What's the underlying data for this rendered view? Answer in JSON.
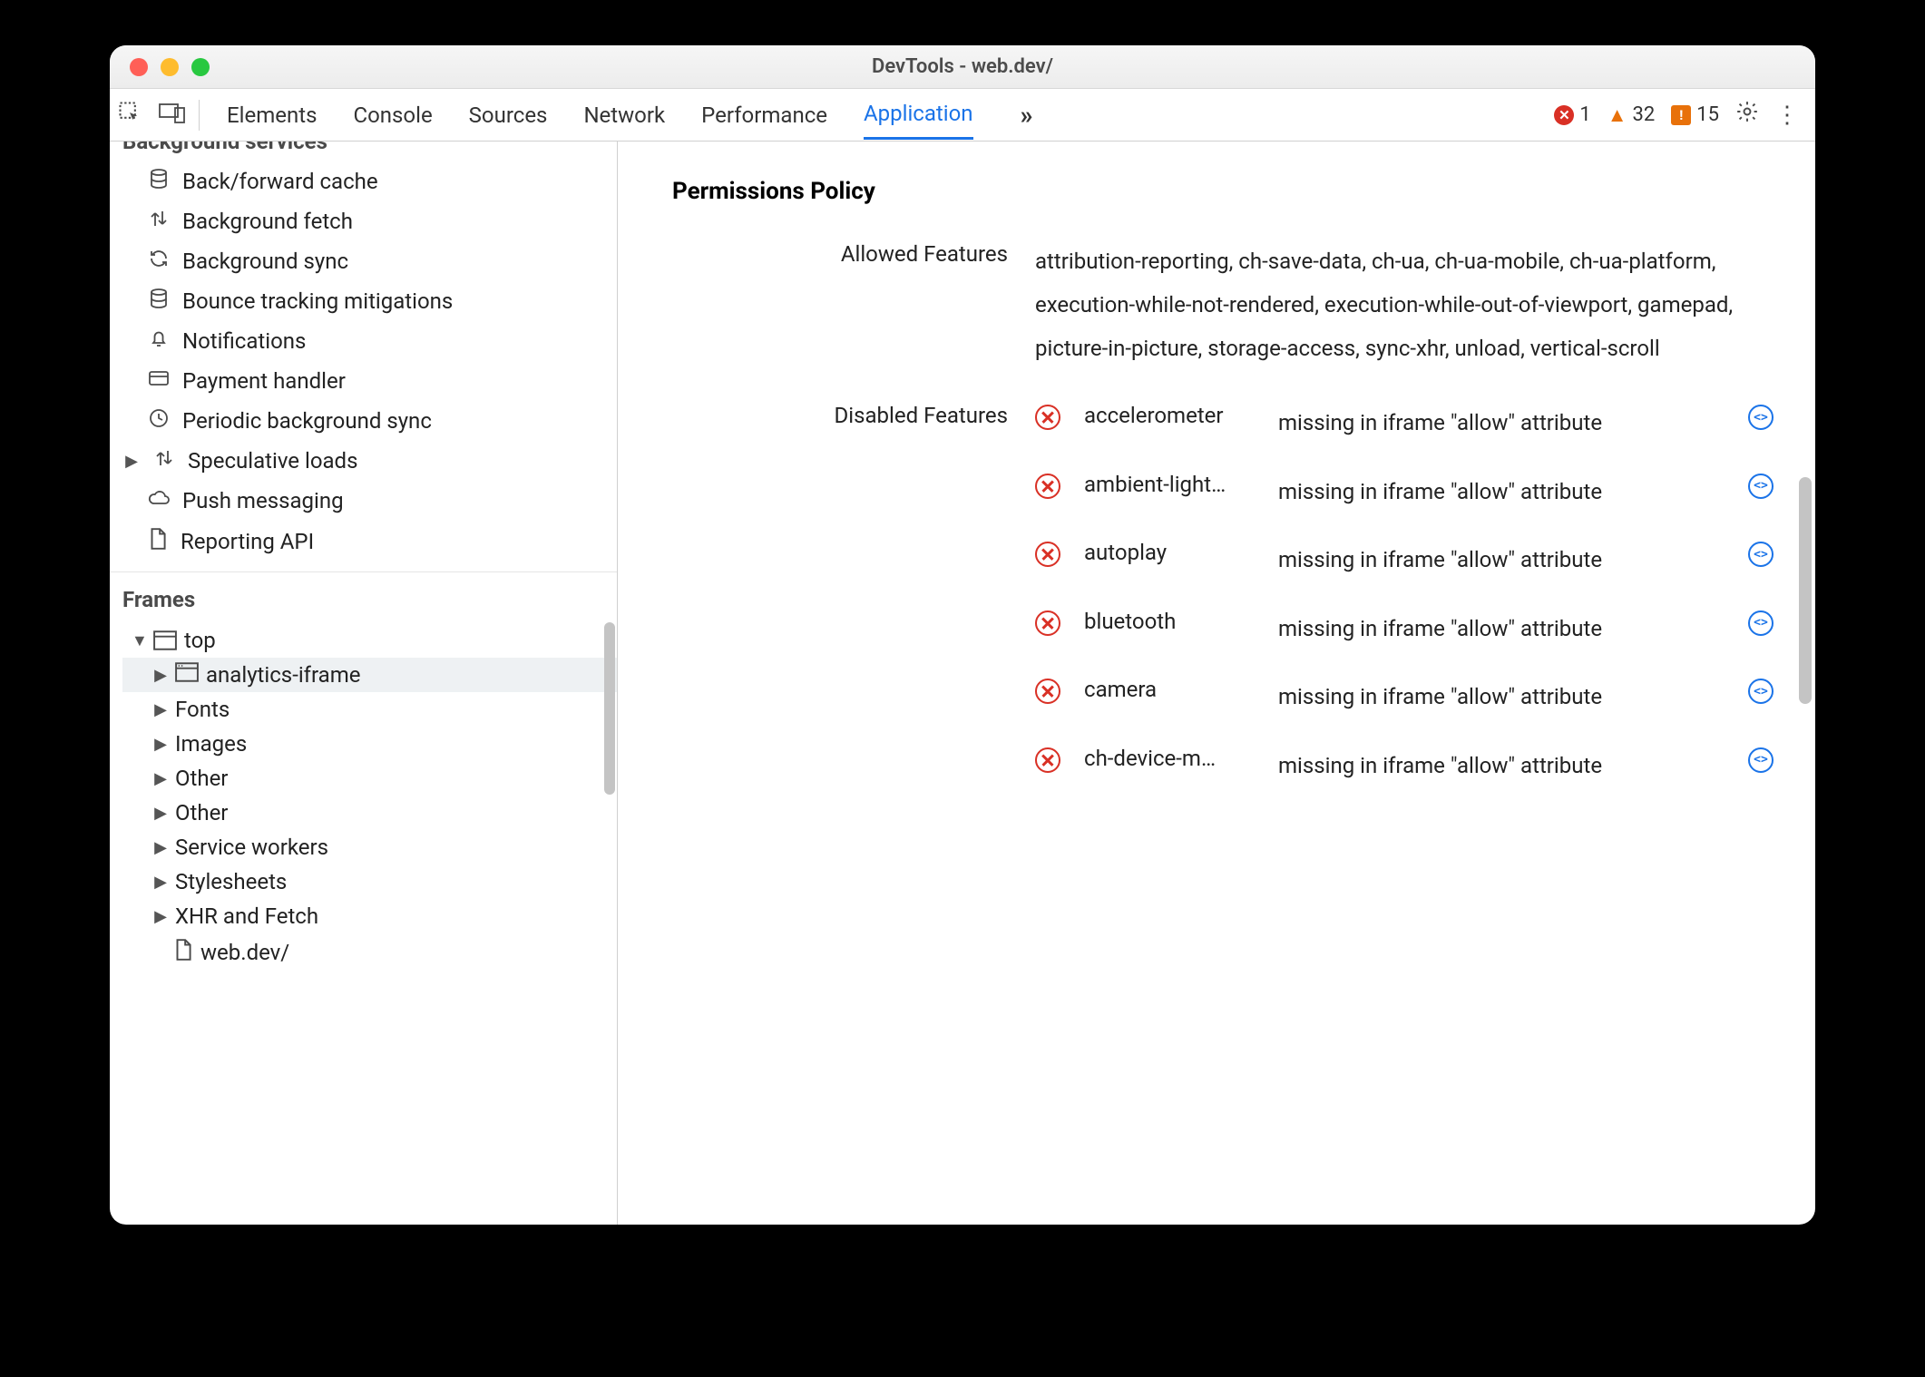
{
  "window": {
    "title": "DevTools - web.dev/"
  },
  "toolbar": {
    "tabs": [
      "Elements",
      "Console",
      "Sources",
      "Network",
      "Performance",
      "Application"
    ],
    "active_tab": "Application",
    "errors": "1",
    "warnings": "32",
    "issues": "15"
  },
  "sidebar": {
    "bg_services_header": "Background services",
    "bg_services": [
      {
        "label": "Back/forward cache",
        "icon": "database"
      },
      {
        "label": "Background fetch",
        "icon": "updown"
      },
      {
        "label": "Background sync",
        "icon": "sync"
      },
      {
        "label": "Bounce tracking mitigations",
        "icon": "database"
      },
      {
        "label": "Notifications",
        "icon": "bell"
      },
      {
        "label": "Payment handler",
        "icon": "card"
      },
      {
        "label": "Periodic background sync",
        "icon": "clock"
      },
      {
        "label": "Speculative loads",
        "icon": "updown",
        "expandable": true
      },
      {
        "label": "Push messaging",
        "icon": "cloud"
      },
      {
        "label": "Reporting API",
        "icon": "file"
      }
    ],
    "frames_header": "Frames",
    "frames": {
      "top": "top",
      "children": [
        {
          "label": "analytics-iframe",
          "icon": "iframe",
          "selected": true
        },
        {
          "label": "Fonts"
        },
        {
          "label": "Images"
        },
        {
          "label": "Other"
        },
        {
          "label": "Other"
        },
        {
          "label": "Service workers"
        },
        {
          "label": "Stylesheets"
        },
        {
          "label": "XHR and Fetch"
        },
        {
          "label": "web.dev/",
          "icon": "file",
          "leaf": true
        }
      ]
    }
  },
  "main": {
    "section_title": "Permissions Policy",
    "allowed_label": "Allowed Features",
    "allowed_value": "attribution-reporting, ch-save-data, ch-ua, ch-ua-mobile, ch-ua-platform, execution-while-not-rendered, execution-while-out-of-viewport, gamepad, picture-in-picture, storage-access, sync-xhr, unload, vertical-scroll",
    "disabled_label": "Disabled Features",
    "disabled": [
      {
        "name": "accelerometer",
        "reason": "missing in iframe \"allow\" attribute"
      },
      {
        "name": "ambient-light…",
        "reason": "missing in iframe \"allow\" attribute"
      },
      {
        "name": "autoplay",
        "reason": "missing in iframe \"allow\" attribute"
      },
      {
        "name": "bluetooth",
        "reason": "missing in iframe \"allow\" attribute"
      },
      {
        "name": "camera",
        "reason": "missing in iframe \"allow\" attribute"
      },
      {
        "name": "ch-device-m…",
        "reason": "missing in iframe \"allow\" attribute"
      }
    ]
  }
}
